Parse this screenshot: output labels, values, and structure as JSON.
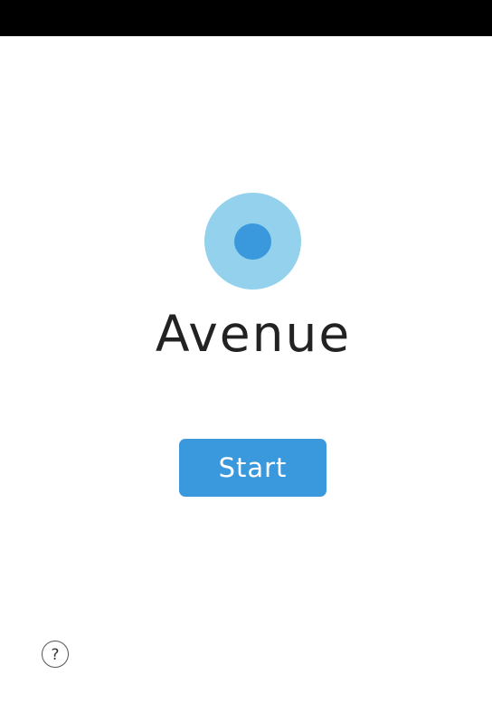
{
  "app": {
    "title": "Avenue"
  },
  "actions": {
    "start_label": "Start"
  },
  "help": {
    "icon": "question-mark-icon",
    "glyph": "?"
  },
  "colors": {
    "status_bar": "#000000",
    "logo_outer": "#93d1ec",
    "logo_inner": "#3a98dd",
    "accent": "#3a98dd",
    "title_text": "#222222",
    "background": "#ffffff"
  }
}
